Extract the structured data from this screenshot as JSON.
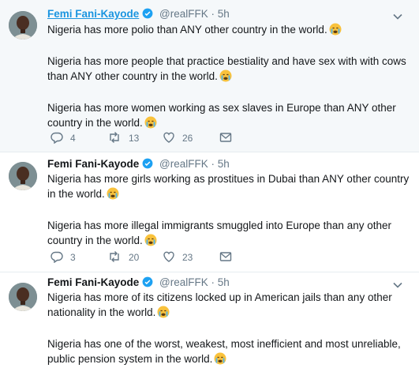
{
  "author": {
    "name": "Femi Fani-Kayode",
    "handle": "@realFFK",
    "separator": "·",
    "time": "5h"
  },
  "tweets": [
    {
      "paragraphs": [
        "Nigeria has more polio than ANY other country in the world.",
        "Nigeria has more people that practice bestiality and have sex with with cows than ANY other country in the world.",
        "Nigeria has more women working as sex slaves in Europe than ANY other country in the world."
      ],
      "replies": "4",
      "retweets": "13",
      "likes": "26"
    },
    {
      "paragraphs": [
        "Nigeria has more girls working as prostitues in Dubai than ANY other country in the world.",
        "Nigeria has more illegal immigrants smuggled into Europe than any other country in the world."
      ],
      "replies": "3",
      "retweets": "20",
      "likes": "23"
    },
    {
      "paragraphs": [
        "Nigeria has more of its citizens locked up in American jails than any other nationality in the world.",
        "Nigeria has one of the worst, weakest, most inefficient and most unreliable, public pension system in the world."
      ]
    }
  ],
  "icons": {
    "reply": "reply-icon",
    "retweet": "retweet-icon",
    "like": "heart-icon",
    "message": "envelope-icon",
    "verified": "verified-badge-icon",
    "caret": "chevron-down-icon",
    "emoji": "crying-face-emoji"
  },
  "colors": {
    "link_blue": "#1b95e0",
    "muted": "#657786",
    "text": "#14171a",
    "highlight_bg": "#f5f8fa"
  }
}
